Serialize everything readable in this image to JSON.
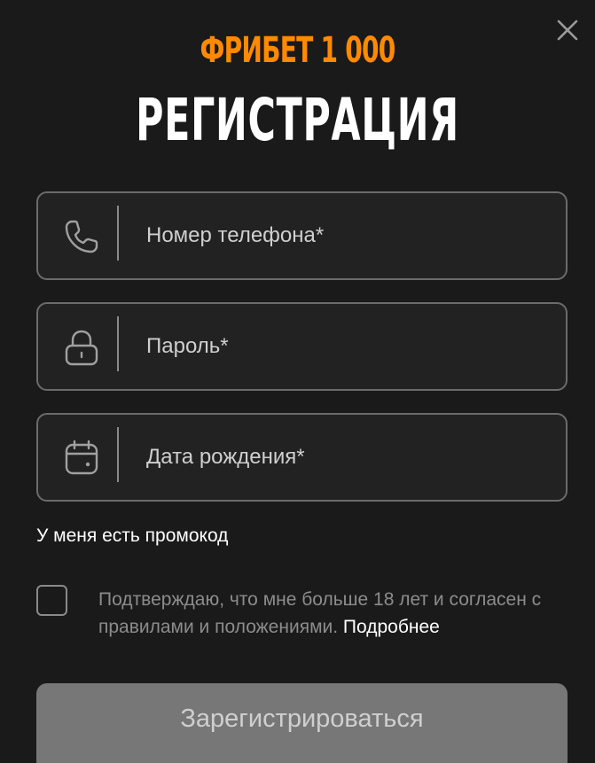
{
  "header": {
    "promo": "ФРИБЕТ 1 000",
    "title": "РЕГИСТРАЦИЯ"
  },
  "fields": {
    "phone": {
      "placeholder": "Номер телефона*",
      "icon": "phone-icon"
    },
    "password": {
      "placeholder": "Пароль*",
      "icon": "lock-icon"
    },
    "birthdate": {
      "placeholder": "Дата рождения*",
      "icon": "calendar-icon"
    }
  },
  "promo_code_link": "У меня есть промокод",
  "agreement": {
    "text": "Подтверждаю, что мне больше 18 лет и согласен с правилами и положениями.",
    "more_link": "Подробнее"
  },
  "submit_label": "Зарегистрироваться",
  "colors": {
    "accent": "#ff8a00",
    "background": "#1a1a1a",
    "button": "#777777"
  }
}
